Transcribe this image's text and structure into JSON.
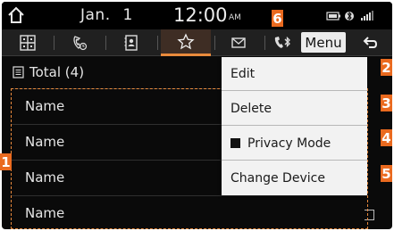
{
  "status_bar": {
    "date": "Jan. 1",
    "time": "12:00",
    "ampm": "AM"
  },
  "tabs": [
    {
      "icon": "keypad-icon",
      "selected": false
    },
    {
      "icon": "call-log-icon",
      "selected": false
    },
    {
      "icon": "contacts-icon",
      "selected": false
    },
    {
      "icon": "favorites-star-icon",
      "selected": true
    },
    {
      "icon": "messages-icon",
      "selected": false
    }
  ],
  "toolbar": {
    "bluetooth_icon": "bluetooth-phone-icon",
    "menu_label": "Menu",
    "back_icon": "back-arrow-icon"
  },
  "list": {
    "total_label": "Total (4)",
    "items": [
      {
        "label": "Name"
      },
      {
        "label": "Name"
      },
      {
        "label": "Name"
      },
      {
        "label": "Name"
      }
    ]
  },
  "menu_dropdown": {
    "items": [
      {
        "label": "Edit"
      },
      {
        "label": "Delete"
      },
      {
        "label": "Privacy Mode",
        "checked": true
      },
      {
        "label": "Change Device"
      }
    ]
  },
  "callouts": {
    "c1": "1",
    "c2": "2",
    "c3": "3",
    "c4": "4",
    "c5": "5",
    "c6": "6"
  },
  "colors": {
    "accent": "#e98a3c",
    "badge": "#ea6a1f",
    "background": "#0a0a0a",
    "dropdown": "#f2f2f2"
  }
}
